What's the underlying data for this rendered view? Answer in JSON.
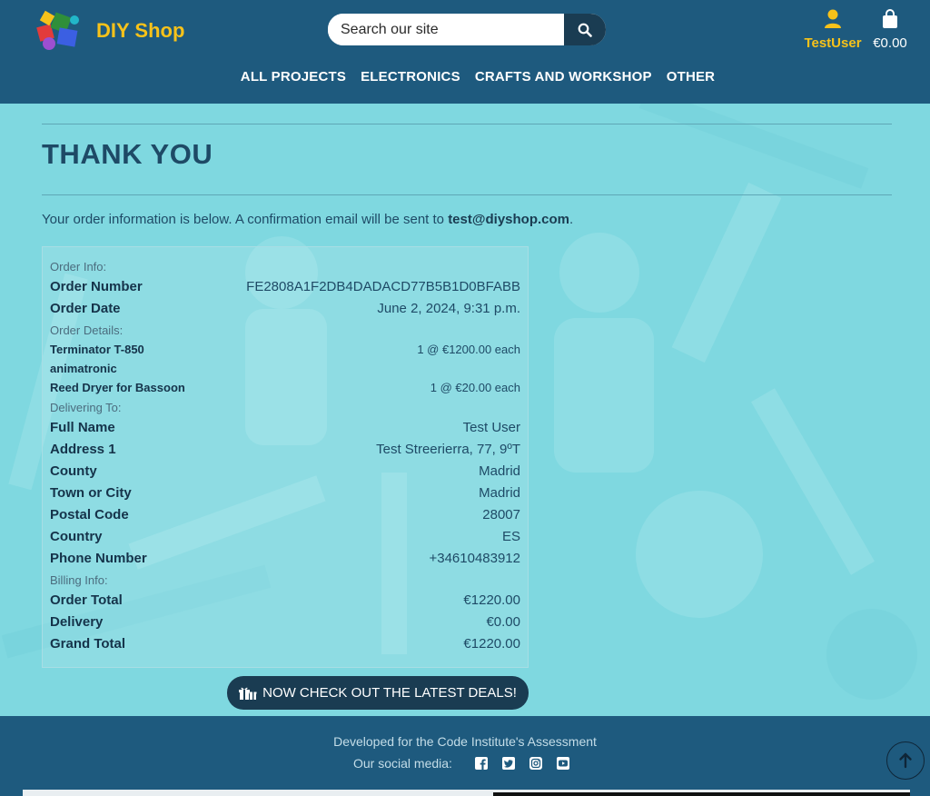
{
  "brand": {
    "name": "DIY Shop"
  },
  "search": {
    "placeholder": "Search our site"
  },
  "account": {
    "label": "TestUser"
  },
  "cart": {
    "total": "€0.00"
  },
  "nav": {
    "items": [
      {
        "label": "ALL PROJECTS"
      },
      {
        "label": "ELECTRONICS"
      },
      {
        "label": "CRAFTS AND WORKSHOP"
      },
      {
        "label": "OTHER"
      }
    ]
  },
  "page": {
    "title": "THANK YOU",
    "intro_prefix": "Your order information is below. A confirmation email will be sent to ",
    "email": "test@diyshop.com",
    "intro_suffix": "."
  },
  "order_info": {
    "label": "Order Info:",
    "number_key": "Order Number",
    "number": "FE2808A1F2DB4DADACD77B5B1D0BFABB",
    "date_key": "Order Date",
    "date": "June 2, 2024, 9:31 p.m."
  },
  "order_details": {
    "label": "Order Details:",
    "items": [
      {
        "name": "Terminator T-850 animatronic",
        "qty_price": "1 @ €1200.00 each"
      },
      {
        "name": "Reed Dryer for Bassoon",
        "qty_price": "1 @ €20.00 each"
      }
    ]
  },
  "delivery": {
    "label": "Delivering To:",
    "rows": [
      {
        "key": "Full Name",
        "value": "Test User"
      },
      {
        "key": "Address 1",
        "value": "Test Streerierra, 77, 9ºT"
      },
      {
        "key": "County",
        "value": "Madrid"
      },
      {
        "key": "Town or City",
        "value": "Madrid"
      },
      {
        "key": "Postal Code",
        "value": "28007"
      },
      {
        "key": "Country",
        "value": "ES"
      },
      {
        "key": "Phone Number",
        "value": "+34610483912"
      }
    ]
  },
  "billing": {
    "label": "Billing Info:",
    "rows": [
      {
        "key": "Order Total",
        "value": "€1220.00"
      },
      {
        "key": "Delivery",
        "value": "€0.00"
      },
      {
        "key": "Grand Total",
        "value": "€1220.00"
      }
    ]
  },
  "deals_button": {
    "label": "NOW CHECK OUT THE LATEST DEALS!"
  },
  "footer": {
    "credit": "Developed for the Code Institute's Assessment",
    "social_label": "Our social media:",
    "social_icons": [
      "facebook-icon",
      "twitter-icon",
      "instagram-icon",
      "youtube-icon"
    ]
  },
  "colors": {
    "header": "#1e5a7e",
    "accent": "#f7c21a",
    "background": "#7fd8e0",
    "button": "#1a3c52"
  }
}
